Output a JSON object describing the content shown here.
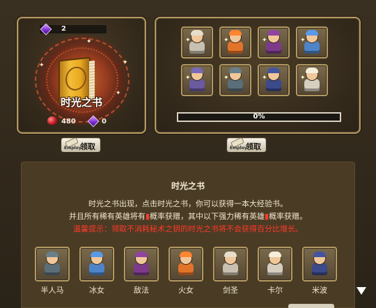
{
  "book_panel": {
    "gem_count": "2",
    "book_title": "时光之书",
    "ruby_count": "480",
    "gem_count_bottom": "0"
  },
  "hero_grid": {
    "heroes": [
      {
        "id": "swordmaster",
        "icon": "swordmaster-icon",
        "color": "#c8c0b0"
      },
      {
        "id": "fire-girl",
        "icon": "fire-girl-icon",
        "color": "#e2742a"
      },
      {
        "id": "enchanter",
        "icon": "enchanter-icon",
        "color": "#7d3a8a"
      },
      {
        "id": "ice-girl",
        "icon": "ice-girl-icon",
        "color": "#4f84c9"
      },
      {
        "id": "dark-hero",
        "icon": "dark-hero-icon",
        "color": "#6a5aa0"
      },
      {
        "id": "centaur",
        "icon": "centaur-icon",
        "color": "#5a6f7a"
      },
      {
        "id": "shadow",
        "icon": "shadow-icon",
        "color": "#3b4a8a"
      },
      {
        "id": "elder",
        "icon": "elder-icon",
        "color": "#d6cfc0"
      }
    ],
    "progress_value": 0,
    "progress_text": "0%"
  },
  "buttons": {
    "claim_label": "领取",
    "claim_mini": "Employ"
  },
  "info": {
    "title": "时光之书",
    "line1": "时光之书出现，点击时光之书，你可以获得一本大经验书。",
    "line2_a": "并且所有稀有英雄将有",
    "line2_b": "概率获赠，其中以下强力稀有英雄",
    "line2_c": "概率获赠。",
    "line3": "温馨提示：领取不消耗秘术之钥的时光之书将不会获得百分比增长。"
  },
  "rewards": [
    {
      "name": "半人马",
      "icon": "centaur-icon",
      "color": "#5a6f7a"
    },
    {
      "name": "冰女",
      "icon": "ice-girl-icon",
      "color": "#4f84c9"
    },
    {
      "name": "敌法",
      "icon": "anti-mage-icon",
      "color": "#7d3a8a"
    },
    {
      "name": "火女",
      "icon": "fire-girl-icon",
      "color": "#e2742a"
    },
    {
      "name": "剑圣",
      "icon": "swordmaster-icon",
      "color": "#c8c0b0"
    },
    {
      "name": "卡尔",
      "icon": "invoker-icon",
      "color": "#d6cfc0"
    },
    {
      "name": "米波",
      "icon": "meepo-icon",
      "color": "#3b4a8a"
    }
  ]
}
